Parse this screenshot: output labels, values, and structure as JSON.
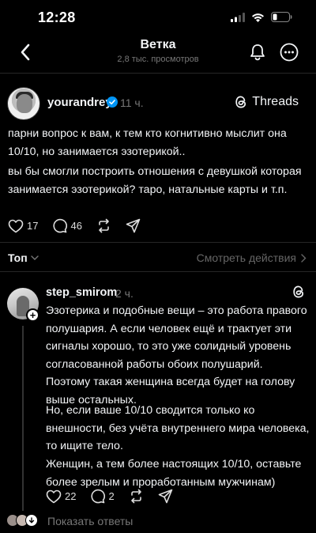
{
  "status_bar": {
    "time": "12:28"
  },
  "header": {
    "title": "Ветка",
    "subtitle": "2,8 тыс. просмотров"
  },
  "post": {
    "username": "yourandrey",
    "verified": true,
    "time": "11 ч.",
    "platform": "Threads",
    "paragraphs": [
      "парни вопрос к вам, к тем кто когнитивно мыслит она 10/10, но занимается эзотерикой..",
      "вы бы смогли построить отношения с девушкой которая занимается эзотерикой? таро, натальные карты и т.п."
    ],
    "likes": "17",
    "comments": "46"
  },
  "sort": {
    "label": "Топ",
    "view_actions": "Смотреть действия"
  },
  "reply": {
    "username": "step_smirom",
    "time": "2 ч.",
    "paragraphs": [
      "Эзотерика и подобные вещи – это работа правого полушария. А если человек ещё и трактует эти сигналы хорошо, то это уже солидный уровень согласованной работы обоих полушарий. Поэтому такая женщина всегда будет на голову выше остальных.",
      "Но, если ваше 10/10 сводится только ко внешности, без учёта внутреннего мира человека, то ищите тело.",
      "Женщин, а тем более настоящих 10/10, оставьте более зрелым и проработанным мужчинам)"
    ],
    "likes": "22",
    "comments": "2"
  },
  "show_replies": {
    "label": "Показать ответы"
  },
  "colors": {
    "background": "#000000",
    "text": "#f3f5f7",
    "muted": "#777777",
    "verified": "#0095f6"
  }
}
